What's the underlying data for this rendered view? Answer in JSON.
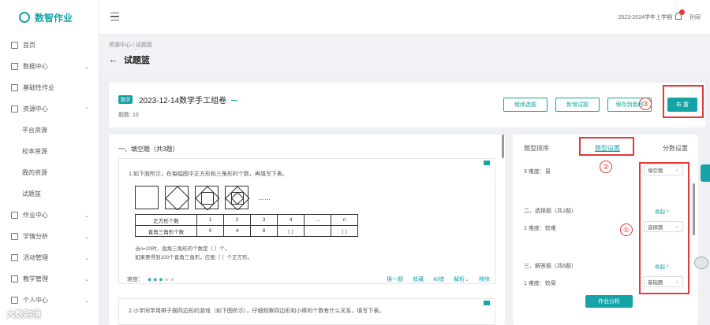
{
  "app": {
    "name": "数智作业"
  },
  "sidebar": {
    "items": [
      {
        "label": "首页",
        "icon": "home-icon"
      },
      {
        "label": "数据中心",
        "icon": "chart-icon",
        "chev": "⌄"
      },
      {
        "label": "基础性作业",
        "icon": "doc-icon"
      },
      {
        "label": "资源中心",
        "icon": "grid-icon",
        "chev": "⌃"
      },
      {
        "label": "平台资源",
        "sub": true
      },
      {
        "label": "校本资源",
        "sub": true
      },
      {
        "label": "我的资源",
        "sub": true
      },
      {
        "label": "试题篮",
        "sub": true
      },
      {
        "label": "作业中心",
        "icon": "edit-icon",
        "chev": "⌄"
      },
      {
        "label": "学情分析",
        "icon": "analysis-icon",
        "chev": "⌄"
      },
      {
        "label": "活动管理",
        "icon": "gift-icon",
        "chev": "⌄"
      },
      {
        "label": "教学管理",
        "icon": "teach-icon",
        "chev": "⌄"
      },
      {
        "label": "个人中心",
        "icon": "user-icon",
        "chev": "⌄"
      }
    ]
  },
  "topbar": {
    "term": "2023-2024学年上学期",
    "user": "孙同",
    "notif": "1"
  },
  "breadcrumb": "资源中心 / 试题篮",
  "page_title": "试题篮",
  "paper": {
    "tag": "数学",
    "name": "2023-12-14数学手工组卷",
    "count": "题数: 10",
    "buttons": {
      "a": "继续选题",
      "b": "新增试题",
      "c": "保存到我的",
      "publish": "布 置"
    }
  },
  "questions": {
    "section": "一、填空题（共3题）",
    "q1": {
      "text": "1.如下面所示，在每幅图中正方形和三角形的个数，再填写下表。",
      "dots": "……",
      "row1": [
        "正方形个数",
        "1",
        "2",
        "3",
        "4",
        "…",
        "n"
      ],
      "row2": [
        "直角三角形个数",
        "0",
        "4",
        "8",
        "（ ）",
        "",
        "（ ）"
      ],
      "note1": "当n=20时，直角三角形的个数是（ ）个。",
      "note2": "如果要得到100个直角三角形，应画（ ）个正方形。",
      "difficulty_label": "难度：",
      "difficulty": 3,
      "actions": [
        "换一题",
        "收藏",
        "纠错",
        "解析⌄",
        "移除"
      ]
    },
    "q2": {
      "text": "2.小字同学用棋子摆四边形的游戏（如下图所示），仔细观察四边形和小棒的个数有什么关系，填写下表。"
    }
  },
  "rpanel": {
    "tabs": [
      "题型排序",
      "题型设置",
      "分数设置"
    ],
    "items": [
      {
        "label": "3 难度：易",
        "select": "填空题"
      },
      {
        "label": "二、选择题（共1题）",
        "collapse": "收起 ^"
      },
      {
        "label": "1 难度：较难",
        "select": "选择题"
      },
      {
        "label": "三、解答题（共6题）",
        "collapse": "收起 ^"
      },
      {
        "label": "1 难度：较易",
        "select": "基础题"
      }
    ],
    "analysis": "作业分析"
  },
  "annotations": [
    "①",
    "②",
    "③"
  ],
  "watermark": "大数跨境"
}
